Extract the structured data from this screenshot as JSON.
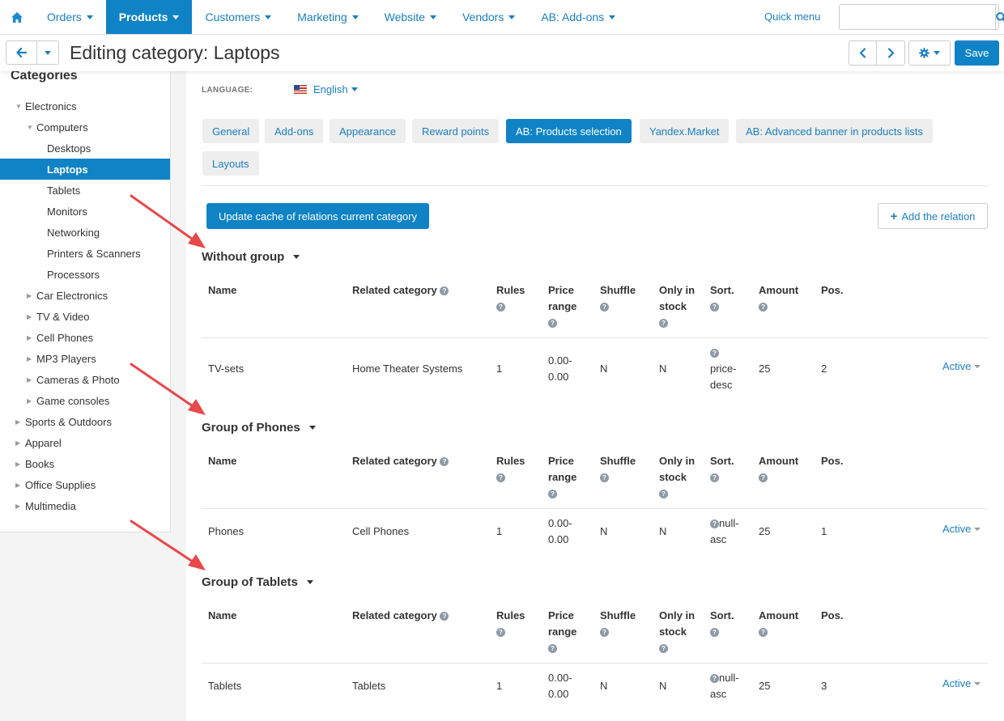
{
  "nav": {
    "items": [
      {
        "label": "Orders",
        "active": false
      },
      {
        "label": "Products",
        "active": true
      },
      {
        "label": "Customers",
        "active": false
      },
      {
        "label": "Marketing",
        "active": false
      },
      {
        "label": "Website",
        "active": false
      },
      {
        "label": "Vendors",
        "active": false
      },
      {
        "label": "AB: Add-ons",
        "active": false
      }
    ],
    "quick_menu": "Quick menu",
    "search_value": ""
  },
  "header": {
    "title": "Editing category: Laptops",
    "save_label": "Save"
  },
  "sidebar": {
    "title": "Categories",
    "items": [
      {
        "label": "Electronics",
        "level": 0,
        "expanded": true,
        "has_children": true
      },
      {
        "label": "Computers",
        "level": 1,
        "expanded": true,
        "has_children": true
      },
      {
        "label": "Desktops",
        "level": 2,
        "has_children": false
      },
      {
        "label": "Laptops",
        "level": 2,
        "has_children": false,
        "active": true
      },
      {
        "label": "Tablets",
        "level": 2,
        "has_children": false
      },
      {
        "label": "Monitors",
        "level": 2,
        "has_children": false
      },
      {
        "label": "Networking",
        "level": 2,
        "has_children": false
      },
      {
        "label": "Printers & Scanners",
        "level": 2,
        "has_children": false
      },
      {
        "label": "Processors",
        "level": 2,
        "has_children": false
      },
      {
        "label": "Car Electronics",
        "level": 1,
        "has_children": true
      },
      {
        "label": "TV & Video",
        "level": 1,
        "has_children": true
      },
      {
        "label": "Cell Phones",
        "level": 1,
        "has_children": true
      },
      {
        "label": "MP3 Players",
        "level": 1,
        "has_children": true
      },
      {
        "label": "Cameras & Photo",
        "level": 1,
        "has_children": true
      },
      {
        "label": "Game consoles",
        "level": 1,
        "has_children": true
      },
      {
        "label": "Sports & Outdoors",
        "level": 0,
        "has_children": true
      },
      {
        "label": "Apparel",
        "level": 0,
        "has_children": true
      },
      {
        "label": "Books",
        "level": 0,
        "has_children": true
      },
      {
        "label": "Office Supplies",
        "level": 0,
        "has_children": true
      },
      {
        "label": "Multimedia",
        "level": 0,
        "has_children": true
      }
    ]
  },
  "language": {
    "label": "LANGUAGE:",
    "value": "English"
  },
  "tabs": [
    {
      "label": "General",
      "active": false
    },
    {
      "label": "Add-ons",
      "active": false
    },
    {
      "label": "Appearance",
      "active": false
    },
    {
      "label": "Reward points",
      "active": false
    },
    {
      "label": "AB: Products selection",
      "active": true
    },
    {
      "label": "Yandex.Market",
      "active": false
    },
    {
      "label": "AB: Advanced banner in products lists",
      "active": false
    },
    {
      "label": "Layouts",
      "active": false
    }
  ],
  "actions": {
    "update_cache": "Update cache of relations current category",
    "add_relation": "Add the relation"
  },
  "columns": {
    "name": "Name",
    "related_category": "Related category",
    "rules": "Rules",
    "price_range_1": "Price",
    "price_range_2": "range",
    "shuffle": "Shuffle",
    "in_stock_1": "Only in",
    "in_stock_2": "stock",
    "sort": "Sort.",
    "amount": "Amount",
    "pos": "Pos."
  },
  "groups": [
    {
      "title": "Without group",
      "row": {
        "name": "TV-sets",
        "related": "Home Theater Systems",
        "rules": "1",
        "price_1": "0.00-",
        "price_2": "0.00",
        "shuffle": "N",
        "stock": "N",
        "sort_1": "price-",
        "sort_2": "desc",
        "amount": "25",
        "pos": "2",
        "status": "Active"
      }
    },
    {
      "title": "Group of Phones",
      "row": {
        "name": "Phones",
        "related": "Cell Phones",
        "rules": "1",
        "price_1": "0.00-",
        "price_2": "0.00",
        "shuffle": "N",
        "stock": "N",
        "sort_1": "null-",
        "sort_2": "asc",
        "amount": "25",
        "pos": "1",
        "status": "Active"
      }
    },
    {
      "title": "Group of Tablets",
      "row": {
        "name": "Tablets",
        "related": "Tablets",
        "rules": "1",
        "price_1": "0.00-",
        "price_2": "0.00",
        "shuffle": "N",
        "stock": "N",
        "sort_1": "null-",
        "sort_2": "asc",
        "amount": "25",
        "pos": "3",
        "status": "Active"
      }
    }
  ],
  "colors": {
    "primary": "#0f83c5",
    "link": "#1a7fc1",
    "annotation_arrow": "#e8484a"
  }
}
